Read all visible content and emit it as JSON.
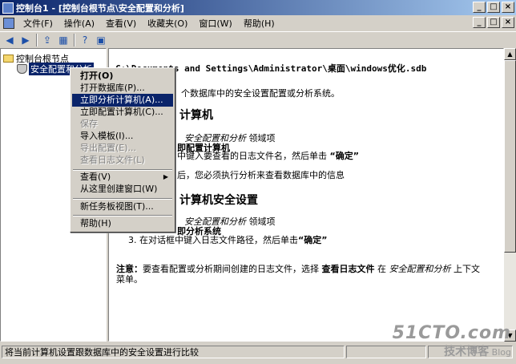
{
  "window": {
    "title": "控制台1 - [控制台根节点\\安全配置和分析]"
  },
  "menubar": [
    "文件(F)",
    "操作(A)",
    "查看(V)",
    "收藏夹(O)",
    "窗口(W)",
    "帮助(H)"
  ],
  "window_buttons": {
    "minimize": "_",
    "maximize": "□",
    "close": "×"
  },
  "tree": {
    "root": "控制台根节点",
    "child": "安全配置和分析"
  },
  "content": {
    "path": "C:\\Documents and Settings\\Administrator\\桌面\\windows优化.sdb",
    "line1": "个数据库中的安全设置配置或分析系统。",
    "heading1": "计算机",
    "line2_italic": "安全配置和分析",
    "line2_rest": " 领域项",
    "line3": "即配置计算机",
    "line4a": "中键入要查看的日志文件名，然后单击 ",
    "line4b": "“确定”",
    "line5": "后，您必须执行分析来查看数据库中的信息",
    "heading2": "计算机安全设置",
    "line6_italic": "安全配置和分析",
    "line6_rest": " 领域项",
    "line7": "即分析系统",
    "line8a": "3.  在对话框中键入日志文件路径，然后单击",
    "line8b": "“确定”",
    "note_label": "注意：",
    "note_text1": "要查看配置或分析期间创建的日志文件，选择 ",
    "note_bold": "查看日志文件",
    "note_text2": " 在 ",
    "note_italic": "安全配置和分析",
    "note_text3": " 上下文",
    "note_text4": "菜单。"
  },
  "context_menu": {
    "open": "打开(O)",
    "open_db": "打开数据库(P)...",
    "analyze": "立即分析计算机(A)...",
    "configure": "立即配置计算机(C)...",
    "save": "保存",
    "import": "导入模板(I)...",
    "export": "导出配置(E)...",
    "view_log": "查看日志文件(L)",
    "view": "查看(V)",
    "new_window": "从这里创建窗口(W)",
    "taskpad": "新任务板视图(T)...",
    "help": "帮助(H)"
  },
  "status": {
    "text": "将当前计算机设置跟数据库中的安全设置进行比较"
  },
  "watermark": {
    "line1": "51CTO.com",
    "line2": "技术博客",
    "line3": "Blog"
  }
}
